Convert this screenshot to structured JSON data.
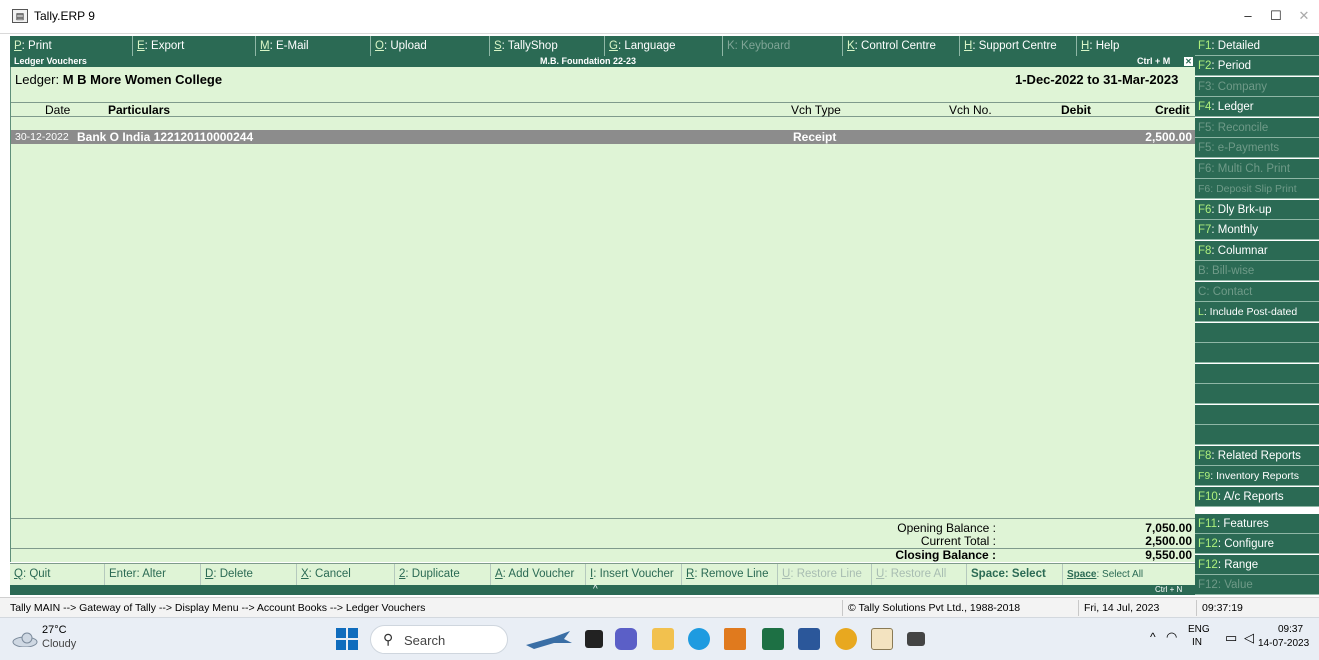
{
  "window": {
    "title": "Tally.ERP 9",
    "icon": "tally-app-icon",
    "controls": [
      "–",
      "☐",
      "✕"
    ]
  },
  "top_menu": [
    {
      "key": "P",
      "label": ": Print",
      "enabled": true
    },
    {
      "key": "E",
      "label": ": Export",
      "enabled": true
    },
    {
      "key": "M",
      "label": ": E-Mail",
      "enabled": true
    },
    {
      "key": "O",
      "label": ": Upload",
      "enabled": true
    },
    {
      "key": "S",
      "label": ": TallyShop",
      "enabled": true
    },
    {
      "key": "G",
      "label": ": Language",
      "enabled": true
    },
    {
      "key": "K",
      "label": ": Keyboard",
      "enabled": false
    },
    {
      "key": "K",
      "label": ": Control Centre",
      "enabled": true
    },
    {
      "key": "H",
      "label": ": Support Centre",
      "enabled": true
    },
    {
      "key": "H",
      "label": ": Help",
      "enabled": true
    }
  ],
  "report": {
    "header_left": "Ledger Vouchers",
    "header_center": "M.B. Foundation 22-23",
    "header_right": "Ctrl + M",
    "close_glyph": "✕",
    "ledger_label": "Ledger:",
    "ledger_name": "M B More Women College",
    "period": "1-Dec-2022 to 31-Mar-2023",
    "columns": {
      "date": "Date",
      "particulars": "Particulars",
      "vch_type": "Vch Type",
      "vch_no": "Vch No.",
      "debit": "Debit",
      "credit": "Credit"
    },
    "rows": [
      {
        "date": "30-12-2022",
        "particulars": "Bank O India 122120110000244",
        "vch_type": "Receipt",
        "vch_no": "",
        "debit": "",
        "credit": "2,500.00"
      }
    ],
    "totals": {
      "opening_label": "Opening Balance :",
      "opening_value": "7,050.00",
      "current_label": "Current Total :",
      "current_value": "2,500.00",
      "closing_label": "Closing Balance :",
      "closing_value": "9,550.00"
    }
  },
  "bottom_bar": [
    {
      "key": "Q",
      "label": ": Quit",
      "enabled": true
    },
    {
      "key": "Enter",
      "label": ": Alter",
      "enabled": true
    },
    {
      "key": "D",
      "label": ": Delete",
      "enabled": true
    },
    {
      "key": "X",
      "label": ": Cancel",
      "enabled": true
    },
    {
      "key": "2",
      "label": ": Duplicate",
      "enabled": true
    },
    {
      "key": "A",
      "label": ": Add Voucher",
      "enabled": true
    },
    {
      "key": "I",
      "label": ": Insert Voucher",
      "enabled": true
    },
    {
      "key": "R",
      "label": ": Remove Line",
      "enabled": true
    },
    {
      "key": "U",
      "label": ": Restore Line",
      "enabled": false
    },
    {
      "key": "U",
      "label": ": Restore All",
      "enabled": false
    },
    {
      "key": "Space",
      "label": ": Select",
      "enabled": true
    },
    {
      "key": "Space",
      "label": ": Select All",
      "enabled": true
    }
  ],
  "ctrl_n": "Ctrl + N",
  "up_arrow": "^",
  "right_buttons": [
    {
      "key": "F1",
      "label": ": Detailed",
      "enabled": true
    },
    {
      "key": "F2",
      "label": ": Period",
      "enabled": true
    },
    {
      "key": "F3",
      "label": ": Company",
      "enabled": false
    },
    {
      "key": "F4",
      "label": ": Ledger",
      "enabled": true
    },
    {
      "key": "F5",
      "label": ": Reconcile",
      "enabled": false
    },
    {
      "key": "F5",
      "label": ": e-Payments",
      "enabled": false
    },
    {
      "key": "F6",
      "label": ": Multi Ch. Print",
      "enabled": false
    },
    {
      "key": "F6",
      "label": ": Deposit Slip Print",
      "enabled": false
    },
    {
      "key": "F6",
      "label": ": Dly Brk-up",
      "enabled": true
    },
    {
      "key": "F7",
      "label": ": Monthly",
      "enabled": true
    },
    {
      "key": "F8",
      "label": ": Columnar",
      "enabled": true
    },
    {
      "key": "B",
      "label": ": Bill-wise",
      "enabled": false
    },
    {
      "key": "C",
      "label": ": Contact",
      "enabled": false
    },
    {
      "key": "L",
      "label": ": Include Post-dated",
      "enabled": true
    }
  ],
  "right_buttons_bottom": [
    {
      "key": "F8",
      "label": ": Related Reports",
      "enabled": true
    },
    {
      "key": "F9",
      "label": ": Inventory Reports",
      "enabled": true
    },
    {
      "key": "F10",
      "label": ": A/c Reports",
      "enabled": true
    },
    {
      "key": "F11",
      "label": ": Features",
      "enabled": true
    },
    {
      "key": "F12",
      "label": ": Configure",
      "enabled": true
    },
    {
      "key": "F12",
      "label": ": Range",
      "enabled": true
    },
    {
      "key": "F12",
      "label": ": Value",
      "enabled": false
    }
  ],
  "status": {
    "breadcrumb": "Tally MAIN --> Gateway of Tally --> Display Menu --> Account Books --> Ledger Vouchers",
    "copyright": "© Tally Solutions Pvt Ltd., 1988-2018",
    "date": "Fri, 14 Jul, 2023",
    "time": "09:37:19"
  },
  "taskbar": {
    "weather_temp": "27°C",
    "weather_desc": "Cloudy",
    "search_placeholder": "Search",
    "lang_top": "ENG",
    "lang_bottom": "IN",
    "clock_time": "09:37",
    "clock_date": "14-07-2023"
  },
  "colors": {
    "tally_green": "#2b6a54",
    "report_bg": "#dff4d6",
    "selected_row": "#8c8c8c",
    "key_highlight": "#aef07d"
  }
}
